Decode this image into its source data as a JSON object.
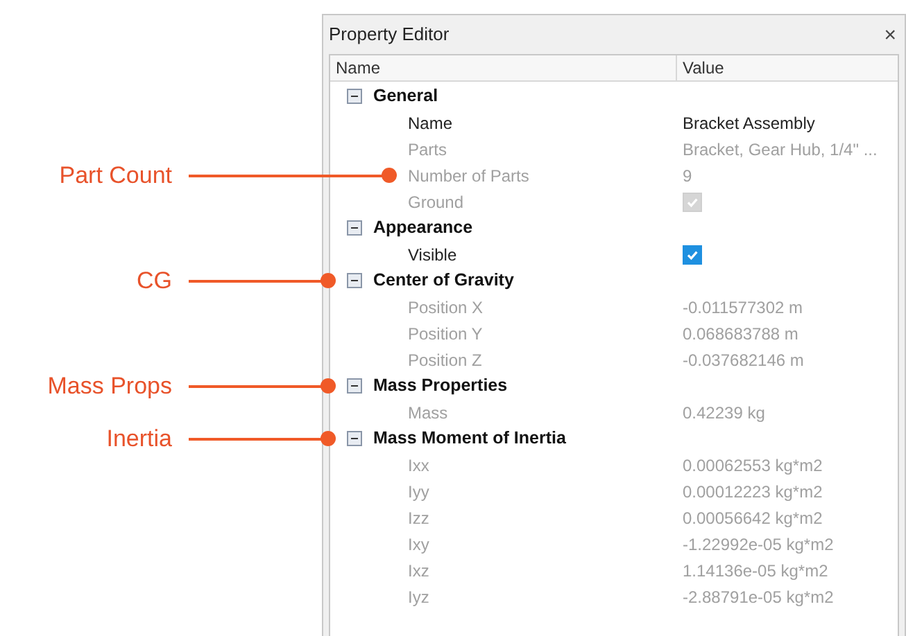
{
  "window": {
    "title": "Property Editor",
    "close": "×"
  },
  "table": {
    "columns": [
      "Name",
      "Value"
    ],
    "groups": [
      {
        "name": "General",
        "expanded": true,
        "items": [
          {
            "kind": "text",
            "name": "Name",
            "value": "Bracket Assembly",
            "disabled": false
          },
          {
            "kind": "text",
            "name": "Parts",
            "value": "Bracket, Gear Hub, 1/4\" ...",
            "disabled": true
          },
          {
            "kind": "text",
            "name": "Number of Parts",
            "value": "9",
            "disabled": true,
            "callout": "Part Count"
          },
          {
            "kind": "checkbox",
            "name": "Ground",
            "checked": true,
            "disabled": true
          }
        ]
      },
      {
        "name": "Appearance",
        "expanded": true,
        "items": [
          {
            "kind": "checkbox",
            "name": "Visible",
            "checked": true,
            "disabled": false
          }
        ]
      },
      {
        "name": "Center of Gravity",
        "expanded": true,
        "callout": "CG",
        "items": [
          {
            "kind": "text",
            "name": "Position X",
            "value": "-0.011577302 m",
            "disabled": true
          },
          {
            "kind": "text",
            "name": "Position Y",
            "value": "0.068683788 m",
            "disabled": true
          },
          {
            "kind": "text",
            "name": "Position Z",
            "value": "-0.037682146 m",
            "disabled": true
          }
        ]
      },
      {
        "name": "Mass Properties",
        "expanded": true,
        "callout": "Mass Props",
        "items": [
          {
            "kind": "text",
            "name": "Mass",
            "value": "0.42239 kg",
            "disabled": true
          }
        ]
      },
      {
        "name": "Mass Moment of Inertia",
        "expanded": true,
        "callout": "Inertia",
        "items": [
          {
            "kind": "text",
            "name": "Ixx",
            "value": "0.00062553 kg*m2",
            "disabled": true
          },
          {
            "kind": "text",
            "name": "Iyy",
            "value": "0.00012223 kg*m2",
            "disabled": true
          },
          {
            "kind": "text",
            "name": "Izz",
            "value": "0.00056642 kg*m2",
            "disabled": true
          },
          {
            "kind": "text",
            "name": "Ixy",
            "value": "-1.22992e-05 kg*m2",
            "disabled": true
          },
          {
            "kind": "text",
            "name": "Ixz",
            "value": "1.14136e-05 kg*m2",
            "disabled": true
          },
          {
            "kind": "text",
            "name": "Iyz",
            "value": "-2.88791e-05 kg*m2",
            "disabled": true
          }
        ]
      }
    ]
  }
}
